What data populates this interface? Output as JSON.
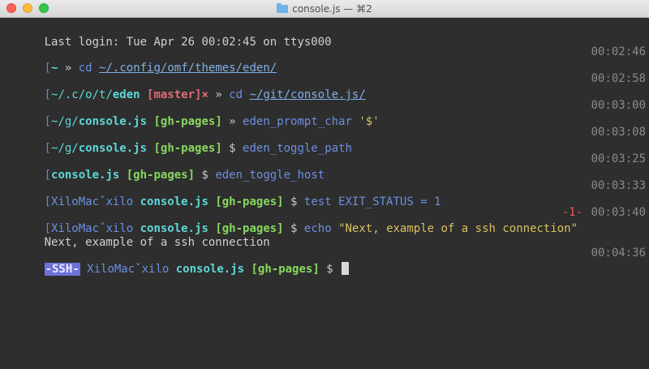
{
  "window": {
    "title": "console.js — ⌘2"
  },
  "terminal": {
    "last_login": "Last login: Tue Apr 26 00:02:45 on ttys000",
    "lines": [
      {
        "time": "00:02:46",
        "parts": [
          "[",
          "~",
          " » ",
          "cd ",
          "~/.config/omf/themes/eden/"
        ]
      },
      {
        "time": "00:02:58",
        "parts": [
          "[",
          "~/.c/o/t/",
          "eden",
          " [master]×",
          " » ",
          "cd ",
          "~/git/console.js/"
        ]
      },
      {
        "time": "00:03:00",
        "parts": [
          "[",
          "~/g/",
          "console.js",
          " [gh-pages]",
          " » ",
          "eden_prompt_char ",
          "'$'"
        ]
      },
      {
        "time": "00:03:08",
        "parts": [
          "[",
          "~/g/",
          "console.js",
          " [gh-pages]",
          " $ ",
          "eden_toggle_path"
        ]
      },
      {
        "time": "00:03:25",
        "parts": [
          "[",
          "console.js",
          " [gh-pages]",
          " $ ",
          "eden_toggle_host"
        ]
      },
      {
        "time": "00:03:33",
        "parts": [
          "[",
          "XiloMacˇxilo ",
          "console.js",
          " [gh-pages]",
          " $ ",
          "test EXIT_STATUS = 1"
        ]
      },
      {
        "time": "00:03:40",
        "status": "-1-",
        "parts": [
          "[",
          "XiloMacˇxilo ",
          "console.js",
          " [gh-pages]",
          " $ ",
          "echo ",
          "\"Next, example of a ssh connection\""
        ]
      },
      {
        "time": "00:04:36",
        "parts": [
          "-SSH-",
          " XiloMacˇxilo ",
          "console.js",
          " [gh-pages]",
          " $ "
        ]
      }
    ],
    "output": "Next, example of a ssh connection"
  }
}
